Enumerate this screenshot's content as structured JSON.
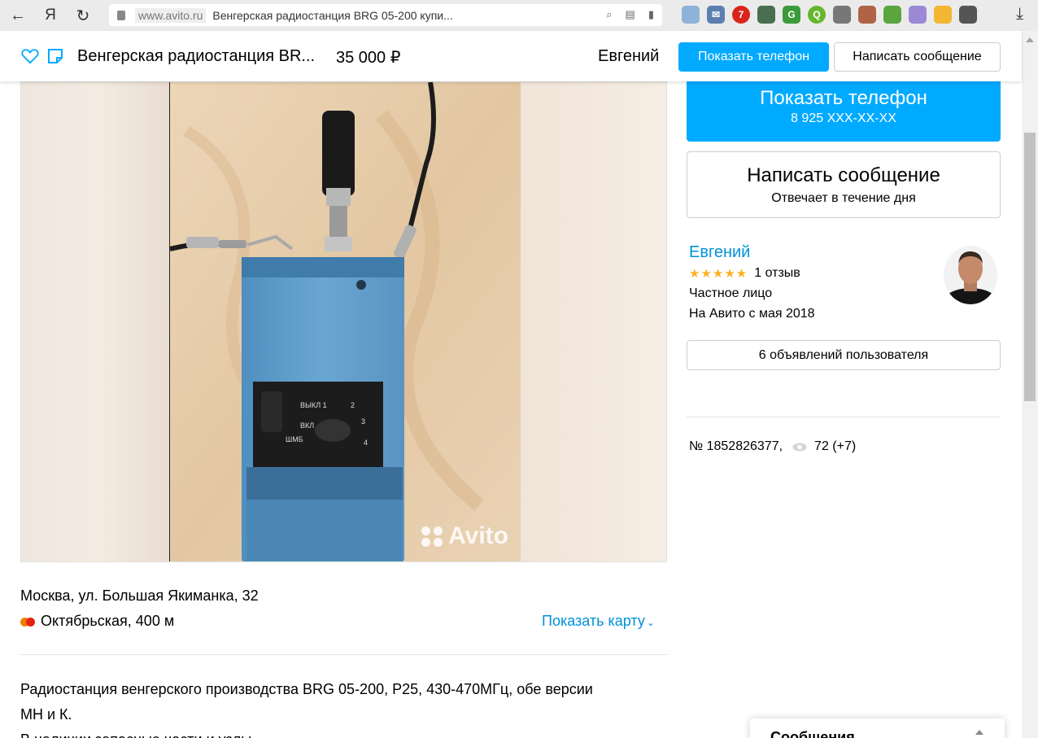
{
  "browser": {
    "domain": "www.avito.ru",
    "tab_title": "Венгерская радиостанция BRG 05-200 купи...",
    "ya_label": "Я"
  },
  "header": {
    "title": "Венгерская радиостанция BR...",
    "price": "35 000  ₽",
    "seller": "Евгений",
    "phone_button": "Показать телефон",
    "message_button": "Написать сообщение"
  },
  "gallery": {
    "watermark": "Avito"
  },
  "location": {
    "address": "Москва, ул. Большая Якиманка, 32",
    "metro": "Октябрьская, 400 м",
    "metro_colors": [
      "#f07d00",
      "#e42313"
    ],
    "map_link": "Показать карту"
  },
  "description": {
    "line1": "Радиостанция венгерского производства BRG 05-200, P25, 430-470МГц, обе версии",
    "line2": "МН и К.",
    "line3": "В наличии запасные части и узлы"
  },
  "contact": {
    "phone_label": "Показать телефон",
    "phone_number": "8 925 XXX-XX-XX",
    "message_label": "Написать сообщение",
    "response_time": "Отвечает в течение дня"
  },
  "seller": {
    "name": "Евгений",
    "rating_stars": "★★★★★",
    "reviews": "1 отзыв",
    "type": "Частное лицо",
    "since": "На Авито с мая 2018",
    "ads_button": "6 объявлений пользователя"
  },
  "listing": {
    "number": "№ 1852826377,",
    "views": "72 (+7)"
  },
  "messages_widget": {
    "label": "Сообщения"
  },
  "colors": {
    "accent": "#00aaff",
    "link": "#0091d9",
    "star": "#ffb021"
  }
}
